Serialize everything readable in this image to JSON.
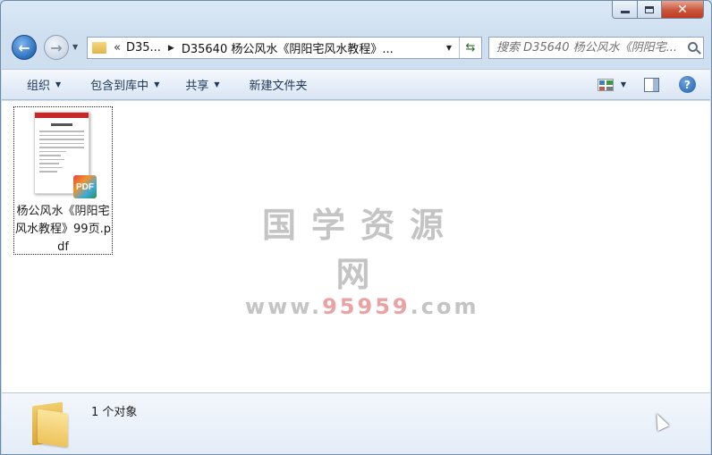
{
  "navigation": {
    "breadcrumb_overflow": "«",
    "breadcrumbs": [
      "D35...",
      "D35640 杨公风水《阴阳宅风水教程》..."
    ]
  },
  "search": {
    "placeholder": "搜索 D35640 杨公风水《阴阳宅..."
  },
  "toolbar": {
    "organize_label": "组织",
    "include_library_label": "包含到库中",
    "share_label": "共享",
    "new_folder_label": "新建文件夹"
  },
  "files": [
    {
      "name": "杨公风水《阴阳宅风水教程》99页.pdf",
      "type_badge": "PDF"
    }
  ],
  "watermark": {
    "title": "国学资源网",
    "url_prefix": "www.",
    "url_number": "95959",
    "url_suffix": ".com"
  },
  "details": {
    "status_text": "1 个对象"
  },
  "colors": {
    "accent": "#1e395b",
    "close_button": "#c9553a",
    "watermark_gray": "#c4c4c4",
    "watermark_red": "#e9a3a3"
  },
  "icons": {
    "back": "back-arrow-icon",
    "forward": "forward-arrow-icon",
    "refresh": "refresh-icon",
    "search": "search-icon",
    "views": "views-icon",
    "preview_pane": "preview-pane-icon",
    "help": "help-icon"
  }
}
